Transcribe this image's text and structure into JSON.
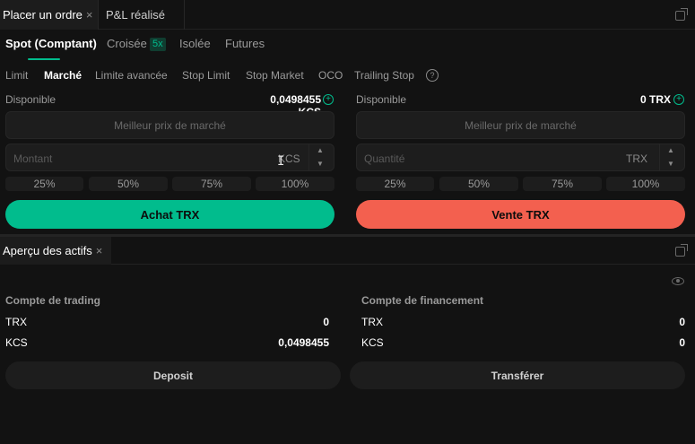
{
  "top_tabs": [
    {
      "label": "Placer un ordre",
      "close": "×"
    },
    {
      "label": "P&L réalisé"
    }
  ],
  "market_tabs": [
    {
      "label": "Spot (Comptant)"
    },
    {
      "label": "Croisée",
      "badge": "5x"
    },
    {
      "label": "Isolée"
    },
    {
      "label": "Futures"
    }
  ],
  "order_types": [
    "Limit",
    "Marché",
    "Limite avancée",
    "Stop Limit",
    "Stop Market",
    "OCO",
    "Trailing Stop"
  ],
  "help_icon": "?",
  "buy_panel": {
    "available_label": "Disponible",
    "available_value": "0,0498455 KCS",
    "price_placeholder": "Meilleur prix de marché",
    "amount_placeholder": "Montant",
    "amount_unit": "KCS",
    "percentages": [
      "25%",
      "50%",
      "75%",
      "100%"
    ],
    "button_label": "Achat TRX"
  },
  "sell_panel": {
    "available_label": "Disponible",
    "available_value": "0 TRX",
    "price_placeholder": "Meilleur prix de marché",
    "quantity_placeholder": "Quantité",
    "quantity_unit": "TRX",
    "percentages": [
      "25%",
      "50%",
      "75%",
      "100%"
    ],
    "button_label": "Vente TRX"
  },
  "assets_tab": {
    "label": "Aperçu des actifs",
    "close": "×"
  },
  "trading_account": {
    "title": "Compte de trading",
    "rows": [
      {
        "asset": "TRX",
        "balance": "0"
      },
      {
        "asset": "KCS",
        "balance": "0,0498455"
      }
    ],
    "button": "Deposit"
  },
  "funding_account": {
    "title": "Compte de financement",
    "rows": [
      {
        "asset": "TRX",
        "balance": "0"
      },
      {
        "asset": "KCS",
        "balance": "0"
      }
    ],
    "button": "Transférer"
  },
  "colors": {
    "buy": "#01bc8d",
    "sell": "#f3604f",
    "background": "#121212"
  }
}
